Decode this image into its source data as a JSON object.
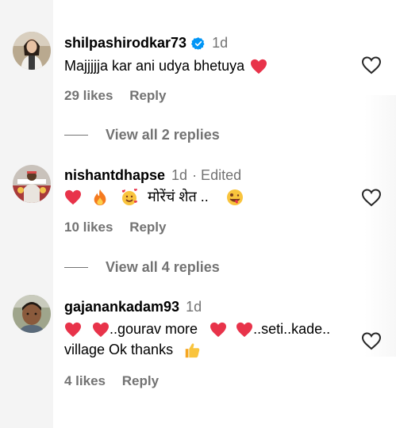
{
  "comments": [
    {
      "username": "shilpashirodkar73",
      "verified": true,
      "time": "1d",
      "edited": "",
      "lines": [
        "Majjjjja kar ani udya bhetuya"
      ],
      "likes": "29 likes",
      "reply": "Reply",
      "view_replies": "View all 2 replies"
    },
    {
      "username": "nishantdhapse",
      "verified": false,
      "time": "1d",
      "edited": "· Edited",
      "text_marathi": "मोरेंचं शेत ..",
      "likes": "10 likes",
      "reply": "Reply",
      "view_replies": "View all 4 replies"
    },
    {
      "username": "gajanankadam93",
      "verified": false,
      "time": "1d",
      "edited": "",
      "line1_a": "..gourav more",
      "line1_b": "..seti..kade..",
      "line2": "village Ok thanks",
      "likes": "4 likes",
      "reply": "Reply"
    }
  ],
  "colors": {
    "heart": "#e8334a",
    "muted": "#737373",
    "verified": "#0095f6"
  }
}
